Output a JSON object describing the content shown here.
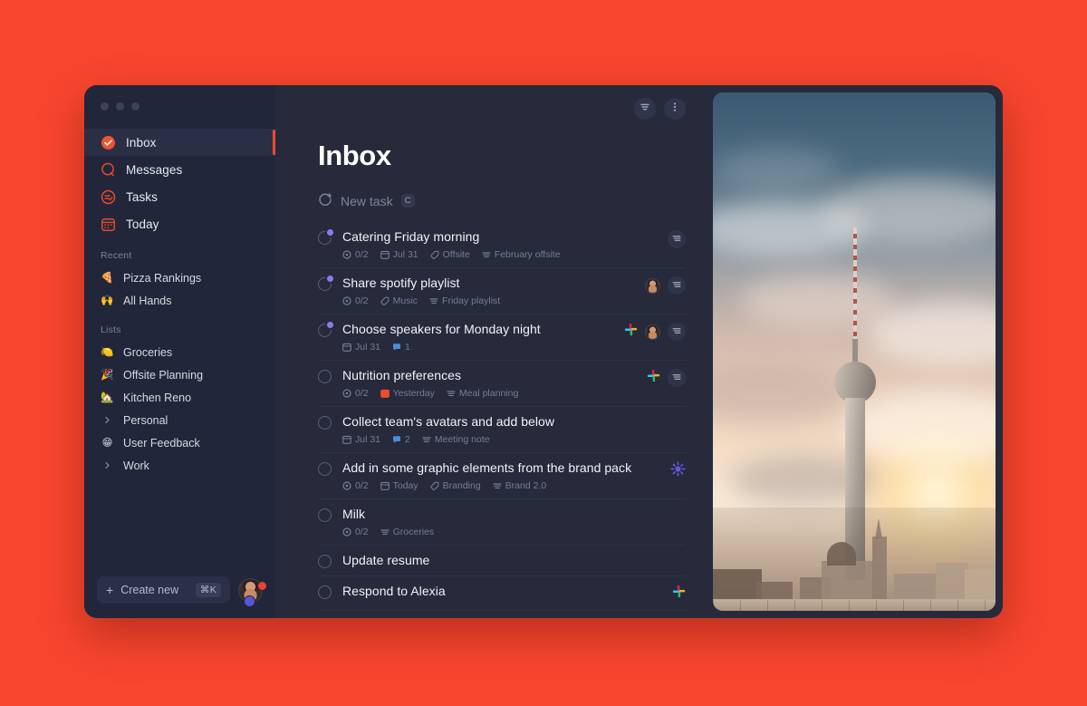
{
  "theme": {
    "desktop_bg": "#f9462e",
    "window_bg": "#262a3b",
    "sidebar_bg": "#22263a",
    "accent": "#ef4b2c",
    "purple_dot": "#8b7bf0"
  },
  "window": {
    "traffic_lights": [
      "close",
      "minimize",
      "zoom"
    ]
  },
  "sidebar": {
    "nav": [
      {
        "label": "Inbox",
        "icon": "inbox-check-icon",
        "active": true
      },
      {
        "label": "Messages",
        "icon": "messages-icon",
        "active": false
      },
      {
        "label": "Tasks",
        "icon": "tasks-icon",
        "active": false
      },
      {
        "label": "Today",
        "icon": "calendar-today-icon",
        "active": false
      }
    ],
    "recent_label": "Recent",
    "recent": [
      {
        "label": "Pizza Rankings",
        "emoji": "🍕"
      },
      {
        "label": "All Hands",
        "emoji": "🙌"
      }
    ],
    "lists_label": "Lists",
    "lists": [
      {
        "label": "Groceries",
        "emoji": "🍋",
        "type": "emoji"
      },
      {
        "label": "Offsite Planning",
        "emoji": "🎉",
        "type": "emoji"
      },
      {
        "label": "Kitchen Reno",
        "emoji": "🏡",
        "type": "emoji"
      },
      {
        "label": "Personal",
        "emoji": "",
        "type": "folder"
      },
      {
        "label": "User Feedback",
        "emoji": "😁",
        "type": "emoji"
      },
      {
        "label": "Work",
        "emoji": "",
        "type": "folder"
      }
    ],
    "footer": {
      "create_label": "Create new",
      "create_shortcut": "⌘K",
      "avatar": "user-avatar"
    }
  },
  "main": {
    "title": "Inbox",
    "toolbar": {
      "filter_icon": "filter-icon",
      "more_icon": "more-vertical-icon"
    },
    "new_task": {
      "label": "New task",
      "shortcut": "C"
    },
    "tasks": [
      {
        "title": "Catering Friday morning",
        "dot": true,
        "meta": [
          {
            "icon": "subtask-icon",
            "text": "0/2",
            "kind": "subtask"
          },
          {
            "icon": "calendar-icon",
            "text": "Jul 31",
            "kind": "date"
          },
          {
            "icon": "tag-icon",
            "text": "Offsite",
            "kind": "tag"
          },
          {
            "icon": "list-icon",
            "text": "February offsite",
            "kind": "list"
          }
        ],
        "right": [
          "row-menu-icon"
        ]
      },
      {
        "title": "Share spotify playlist",
        "dot": true,
        "meta": [
          {
            "icon": "subtask-icon",
            "text": "0/2",
            "kind": "subtask"
          },
          {
            "icon": "tag-icon",
            "text": "Music",
            "kind": "tag"
          },
          {
            "icon": "list-icon",
            "text": "Friday playlist",
            "kind": "list"
          }
        ],
        "right": [
          "avatar",
          "row-menu-icon"
        ]
      },
      {
        "title": "Choose speakers for Monday night",
        "dot": true,
        "meta": [
          {
            "icon": "calendar-icon",
            "text": "Jul 31",
            "kind": "date"
          },
          {
            "icon": "comment-icon",
            "text": "1",
            "kind": "comment"
          }
        ],
        "right": [
          "slack-icon",
          "avatar",
          "row-menu-icon"
        ]
      },
      {
        "title": "Nutrition preferences",
        "dot": false,
        "meta": [
          {
            "icon": "subtask-icon",
            "text": "0/2",
            "kind": "subtask"
          },
          {
            "icon": "calendar-icon",
            "text": "Yesterday",
            "kind": "overdue"
          },
          {
            "icon": "list-icon",
            "text": "Meal planning",
            "kind": "list"
          }
        ],
        "right": [
          "slack-icon",
          "row-menu-icon"
        ]
      },
      {
        "title": "Collect team's avatars and add below",
        "dot": false,
        "meta": [
          {
            "icon": "calendar-icon",
            "text": "Jul 31",
            "kind": "date"
          },
          {
            "icon": "comment-icon",
            "text": "2",
            "kind": "comment"
          },
          {
            "icon": "list-icon",
            "text": "Meeting note",
            "kind": "list"
          }
        ],
        "right": []
      },
      {
        "title": "Add in some graphic elements from the brand pack",
        "dot": false,
        "meta": [
          {
            "icon": "subtask-icon",
            "text": "0/2",
            "kind": "subtask"
          },
          {
            "icon": "calendar-icon",
            "text": "Today",
            "kind": "date"
          },
          {
            "icon": "tag-icon",
            "text": "Branding",
            "kind": "tag"
          },
          {
            "icon": "list-icon",
            "text": "Brand 2.0",
            "kind": "list"
          }
        ],
        "right": [
          "sparkle-icon"
        ]
      },
      {
        "title": "Milk",
        "dot": false,
        "meta": [
          {
            "icon": "subtask-icon",
            "text": "0/2",
            "kind": "subtask"
          },
          {
            "icon": "list-icon",
            "text": "Groceries",
            "kind": "list"
          }
        ],
        "right": []
      },
      {
        "title": "Update resume",
        "dot": false,
        "meta": [],
        "right": []
      },
      {
        "title": "Respond to Alexia",
        "dot": false,
        "meta": [],
        "right": [
          "slack-icon"
        ]
      }
    ]
  },
  "photo_panel": {
    "name": "berlin-tv-tower-sunset-photo",
    "alt": "Berlin TV Tower at sunset with city skyline"
  }
}
